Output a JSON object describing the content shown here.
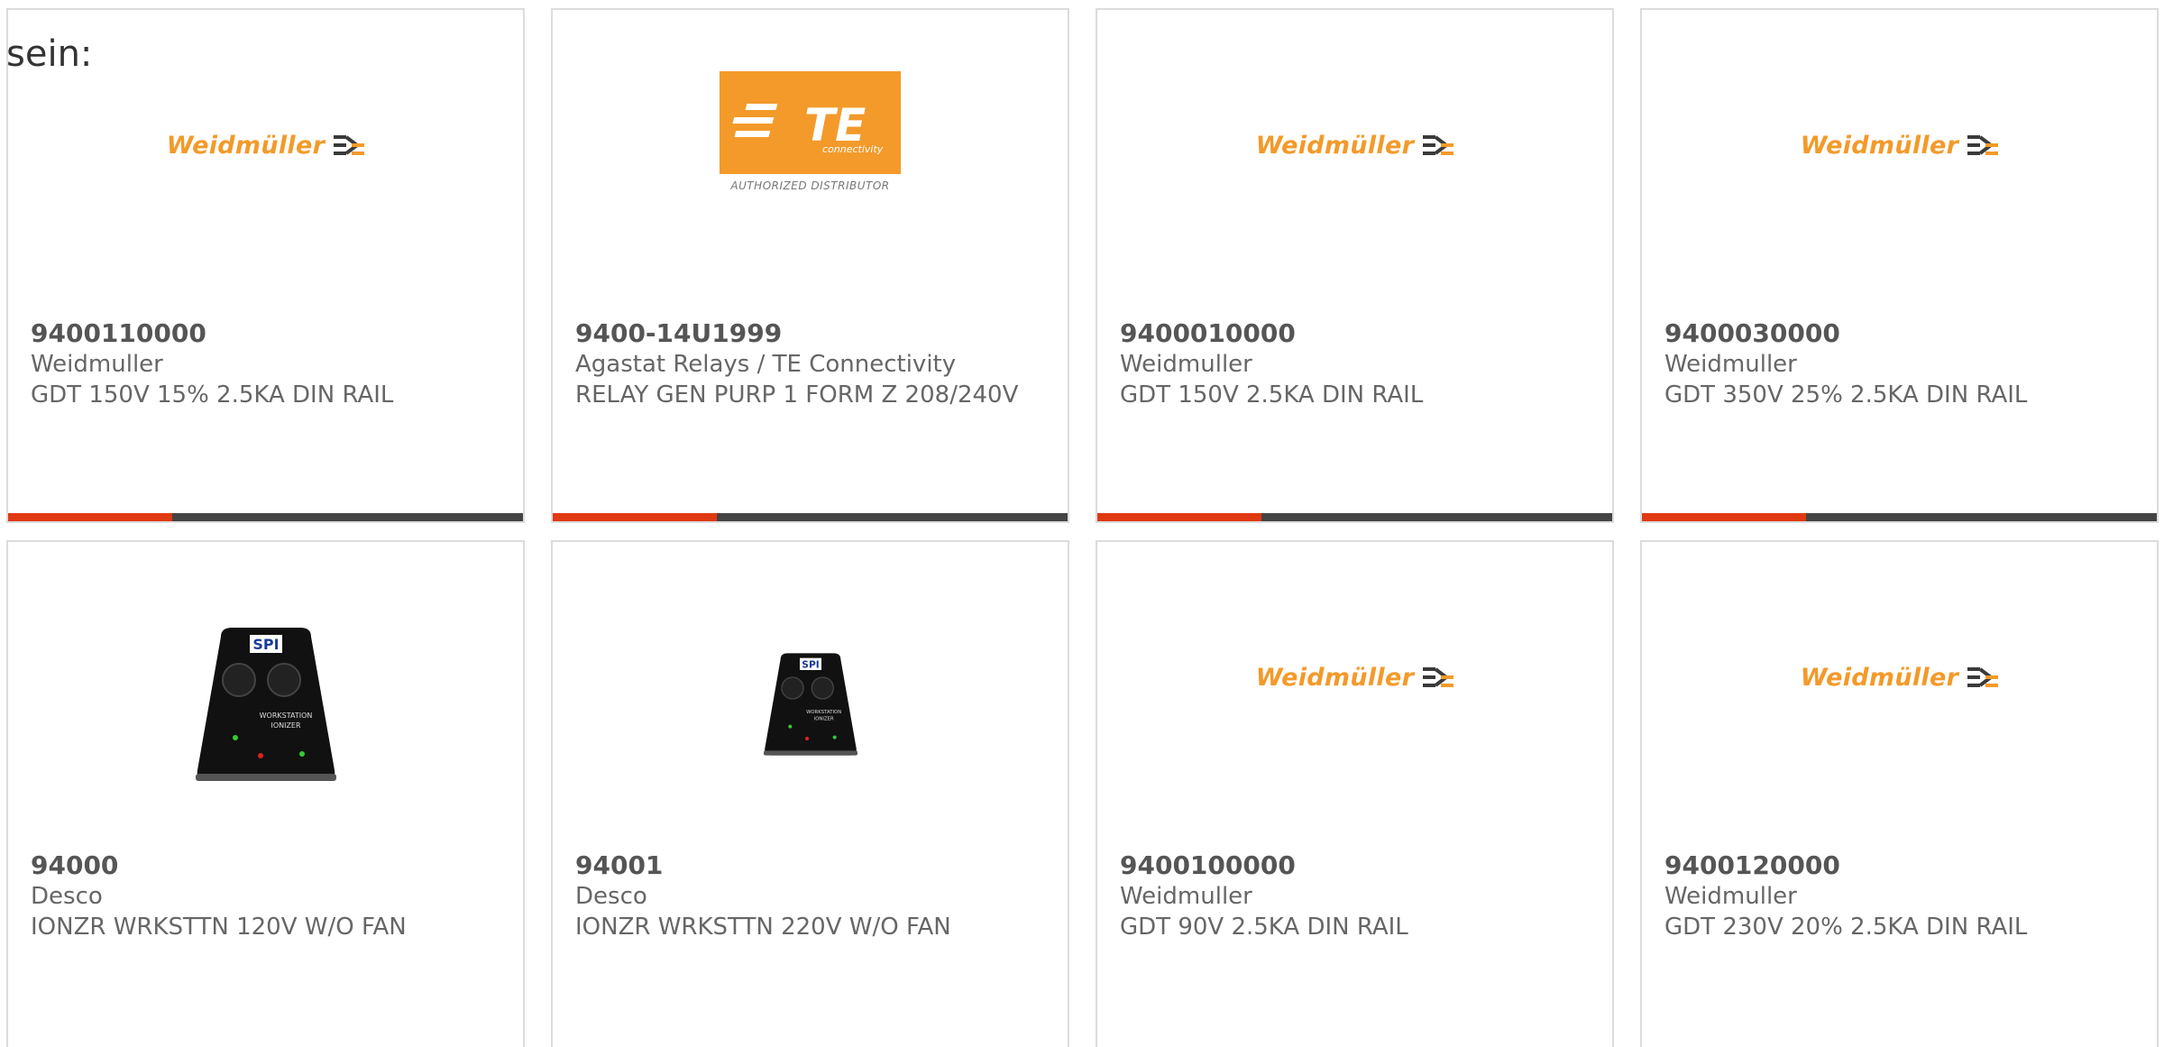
{
  "intro": {
    "text": "sein:"
  },
  "products": [
    {
      "part_number": "9400110000",
      "manufacturer": "Weidmuller",
      "description": "GDT 150V 15% 2.5KA DIN RAIL",
      "image": "weidmuller-logo"
    },
    {
      "part_number": "9400-14U1999",
      "manufacturer": "Agastat Relays / TE Connectivity",
      "description": "RELAY GEN PURP 1 FORM Z 208/240V",
      "image": "te-connectivity-logo"
    },
    {
      "part_number": "9400010000",
      "manufacturer": "Weidmuller",
      "description": "GDT 150V 2.5KA DIN RAIL",
      "image": "weidmuller-logo"
    },
    {
      "part_number": "9400030000",
      "manufacturer": "Weidmuller",
      "description": "GDT 350V 25% 2.5KA DIN RAIL",
      "image": "weidmuller-logo"
    },
    {
      "part_number": "94000",
      "manufacturer": "Desco",
      "description": "IONZR WRKSTTN 120V W/O FAN",
      "image": "ionizer-photo"
    },
    {
      "part_number": "94001",
      "manufacturer": "Desco",
      "description": "IONZR WRKSTTN 220V W/O FAN",
      "image": "ionizer-photo"
    },
    {
      "part_number": "9400100000",
      "manufacturer": "Weidmuller",
      "description": "GDT 90V 2.5KA DIN RAIL",
      "image": "weidmuller-logo"
    },
    {
      "part_number": "9400120000",
      "manufacturer": "Weidmuller",
      "description": "GDT 230V 20% 2.5KA DIN RAIL",
      "image": "weidmuller-logo"
    }
  ],
  "logos": {
    "weidmuller_text": "Weidmüller",
    "te_text": "TE",
    "te_sub": "connectivity",
    "te_tag": "AUTHORIZED DISTRIBUTOR",
    "ionizer_brand": "SPI",
    "ionizer_label_1": "WORKSTATION",
    "ionizer_label_2": "IONIZER"
  },
  "colors": {
    "accent_bar": "#e03a12",
    "dark_bar": "#444444",
    "logo_orange": "#f39a2a"
  }
}
